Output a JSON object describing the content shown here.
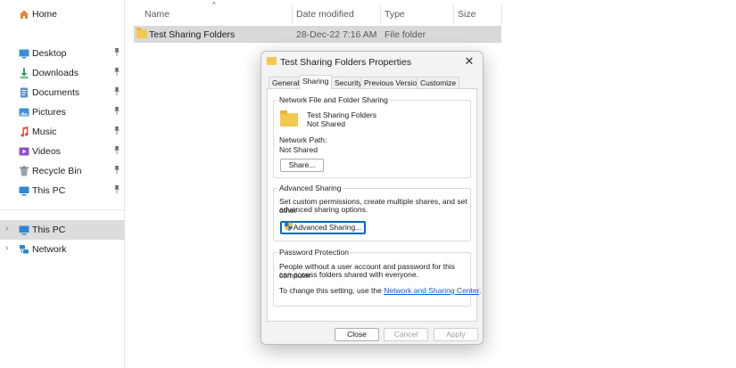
{
  "sidebar": {
    "quick_access": [
      {
        "label": "Home",
        "icon": "home-icon"
      },
      {
        "label": "Desktop",
        "icon": "desktop-icon"
      },
      {
        "label": "Downloads",
        "icon": "downloads-icon"
      },
      {
        "label": "Documents",
        "icon": "documents-icon"
      },
      {
        "label": "Pictures",
        "icon": "pictures-icon"
      },
      {
        "label": "Music",
        "icon": "music-icon"
      },
      {
        "label": "Videos",
        "icon": "videos-icon"
      },
      {
        "label": "Recycle Bin",
        "icon": "recycle-bin-icon"
      },
      {
        "label": "This PC",
        "icon": "this-pc-icon"
      }
    ],
    "tree": [
      {
        "label": "This PC",
        "icon": "this-pc-icon",
        "selected": true
      },
      {
        "label": "Network",
        "icon": "network-icon",
        "selected": false
      }
    ],
    "pin_glyph": "📌"
  },
  "file_list": {
    "columns": [
      "Name",
      "Date modified",
      "Type",
      "Size"
    ],
    "rows": [
      {
        "name": "Test Sharing Folders",
        "date": "28-Dec-22 7:16 AM",
        "type": "File folder",
        "size": ""
      }
    ]
  },
  "dialog": {
    "title": "Test Sharing Folders Properties",
    "close_glyph": "✕",
    "tabs": [
      "General",
      "Sharing",
      "Security",
      "Previous Versions",
      "Customize"
    ],
    "active_tab": "Sharing",
    "network_sharing": {
      "group_title": "Network File and Folder Sharing",
      "folder_name": "Test Sharing Folders",
      "folder_status": "Not Shared",
      "path_label": "Network Path:",
      "path_value": "Not Shared",
      "share_button": "Share..."
    },
    "advanced_sharing": {
      "group_title": "Advanced Sharing",
      "description_line1": "Set custom permissions, create multiple shares, and set other",
      "description_line2": "advanced sharing options.",
      "button": "Advanced Sharing..."
    },
    "password_protection": {
      "group_title": "Password Protection",
      "description_line1": "People without a user account and password for this computer",
      "description_line2": "can access folders shared with everyone.",
      "change_prefix": "To change this setting, use the ",
      "change_link": "Network and Sharing Center",
      "change_suffix": "."
    },
    "buttons": {
      "close": "Close",
      "cancel": "Cancel",
      "apply": "Apply"
    }
  },
  "colors": {
    "folder": "#f3c84f",
    "link": "#0066cc",
    "selection": "#d9d9d9",
    "focus": "#0067c0"
  }
}
